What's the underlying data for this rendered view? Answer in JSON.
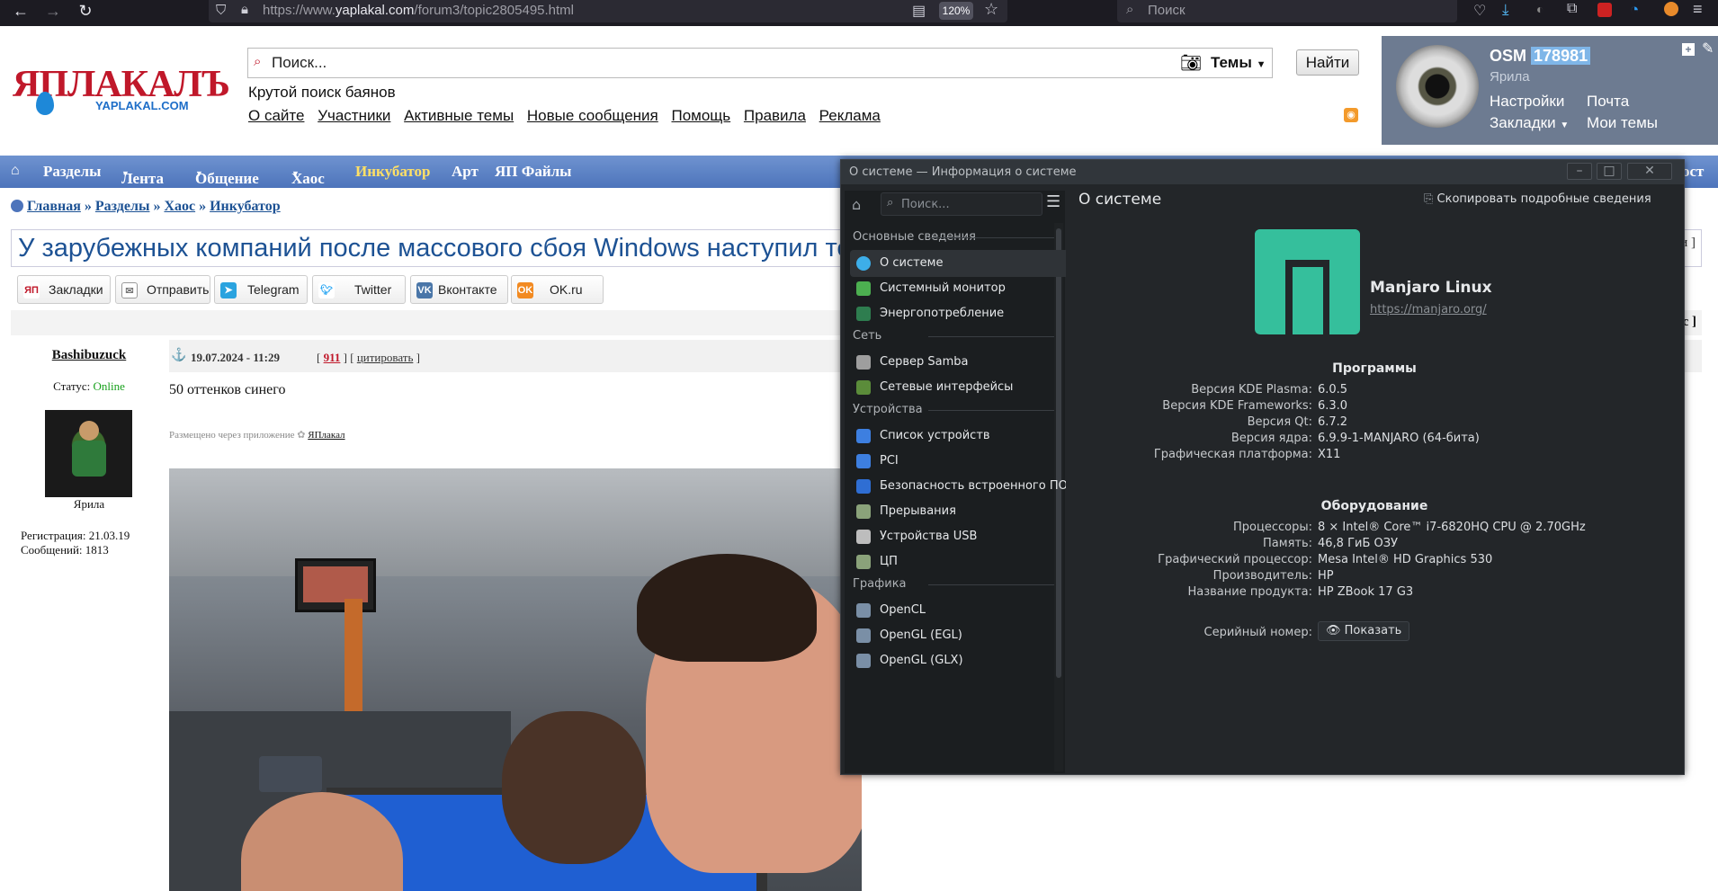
{
  "browser": {
    "url_prefix": "https://www.",
    "url_domain": "yaplakal.com",
    "url_path": "/forum3/topic2805495.html",
    "zoom": "120%",
    "search_placeholder": "Поиск"
  },
  "site": {
    "logo_main": "ЯПЛАКАЛЪ",
    "logo_sub": "YAPLAKAL.COM",
    "search_placeholder": "Поиск...",
    "themes_label": "Темы",
    "find_button": "Найти",
    "tagline": "Крутой поиск баянов",
    "top_links": [
      "О сайте",
      "Участники",
      "Активные темы",
      "Новые сообщения",
      "Помощь",
      "Правила",
      "Реклама"
    ],
    "user": {
      "name": "OSM",
      "id": "178981",
      "rank": "Ярила",
      "links": [
        "Настройки",
        "Почта",
        "Закладки",
        "Мои темы"
      ]
    },
    "nav": [
      "Разделы",
      "Лента",
      "Общение",
      "Хаос",
      "Инкубатор",
      "Арт",
      "ЯП Файлы"
    ],
    "nav_right": "ост",
    "breadcrumbs": [
      "Главная",
      "Разделы",
      "Хаос",
      "Инкубатор"
    ],
    "topic_title": "У зарубежных компаний после массового сбоя Windows наступил те",
    "share": [
      "Закладки",
      "Отправить",
      "Telegram",
      "Twitter",
      "Вконтакте",
      "OK.ru"
    ],
    "right_marker_1": "и ]",
    "right_marker_2": "с ]",
    "post": {
      "author": "Bashibuzuck",
      "date": "19.07.2024 - 11:29",
      "rating": "911",
      "quote": "цитировать",
      "status_label": "Статус:",
      "status_value": "Online",
      "rank": "Ярила",
      "reg": "Регистрация: 21.03.19",
      "messages": "Сообщений: 1813",
      "text": "50 оттенков синего",
      "via_label": "Размещено через приложение",
      "via_app": "ЯПлакал"
    }
  },
  "kde": {
    "title": "О системе — Информация о системе",
    "search_placeholder": "Поиск...",
    "page_title": "О системе",
    "copy_button": "Скопировать подробные сведения",
    "sidebar": [
      {
        "type": "group",
        "label": "Основные сведения"
      },
      {
        "type": "item",
        "label": "О системе",
        "icon": "info-icon",
        "color": "#3daee9",
        "selected": true
      },
      {
        "type": "item",
        "label": "Системный монитор",
        "icon": "monitor-icon",
        "color": "#4caf50"
      },
      {
        "type": "item",
        "label": "Энергопотребление",
        "icon": "energy-icon",
        "color": "#2e7d4f"
      },
      {
        "type": "group",
        "label": "Сеть"
      },
      {
        "type": "item",
        "label": "Сервер Samba",
        "icon": "samba-icon",
        "color": "#9e9e9e"
      },
      {
        "type": "item",
        "label": "Сетевые интерфейсы",
        "icon": "network-icon",
        "color": "#5b8c3a"
      },
      {
        "type": "group",
        "label": "Устройства"
      },
      {
        "type": "item",
        "label": "Список устройств",
        "icon": "devices-icon",
        "color": "#3d7fe0"
      },
      {
        "type": "item",
        "label": "PCI",
        "icon": "pci-icon",
        "color": "#3d7fe0"
      },
      {
        "type": "item",
        "label": "Безопасность встроенного ПО",
        "icon": "shield-icon",
        "color": "#2f6ed3"
      },
      {
        "type": "item",
        "label": "Прерывания",
        "icon": "interrupts-icon",
        "color": "#8aa27a"
      },
      {
        "type": "item",
        "label": "Устройства USB",
        "icon": "usb-icon",
        "color": "#bdbdbd"
      },
      {
        "type": "item",
        "label": "ЦП",
        "icon": "cpu-icon",
        "color": "#8aa27a"
      },
      {
        "type": "group",
        "label": "Графика"
      },
      {
        "type": "item",
        "label": "OpenCL",
        "icon": "opencl-icon",
        "color": "#7a8fa6"
      },
      {
        "type": "item",
        "label": "OpenGL (EGL)",
        "icon": "opengl-icon",
        "color": "#7a8fa6"
      },
      {
        "type": "item",
        "label": "OpenGL (GLX)",
        "icon": "opengl-icon",
        "color": "#7a8fa6"
      }
    ],
    "distro": "Manjaro Linux",
    "distro_url": "https://manjaro.org/",
    "logo_color": "#35bf9c",
    "software_title": "Программы",
    "software": [
      {
        "k": "Версия KDE Plasma:",
        "v": "6.0.5"
      },
      {
        "k": "Версия KDE Frameworks:",
        "v": "6.3.0"
      },
      {
        "k": "Версия Qt:",
        "v": "6.7.2"
      },
      {
        "k": "Версия ядра:",
        "v": "6.9.9-1-MANJARO (64-бита)"
      },
      {
        "k": "Графическая платформа:",
        "v": "X11"
      }
    ],
    "hardware_title": "Оборудование",
    "hardware": [
      {
        "k": "Процессоры:",
        "v": "8 × Intel® Core™ i7-6820HQ CPU @ 2.70GHz"
      },
      {
        "k": "Память:",
        "v": "46,8 ГиБ ОЗУ"
      },
      {
        "k": "Графический процессор:",
        "v": "Mesa Intel® HD Graphics 530"
      },
      {
        "k": "Производитель:",
        "v": "HP"
      },
      {
        "k": "Название продукта:",
        "v": "HP ZBook 17 G3"
      }
    ],
    "serial_label": "Серийный номер:",
    "serial_button": "Показать"
  }
}
